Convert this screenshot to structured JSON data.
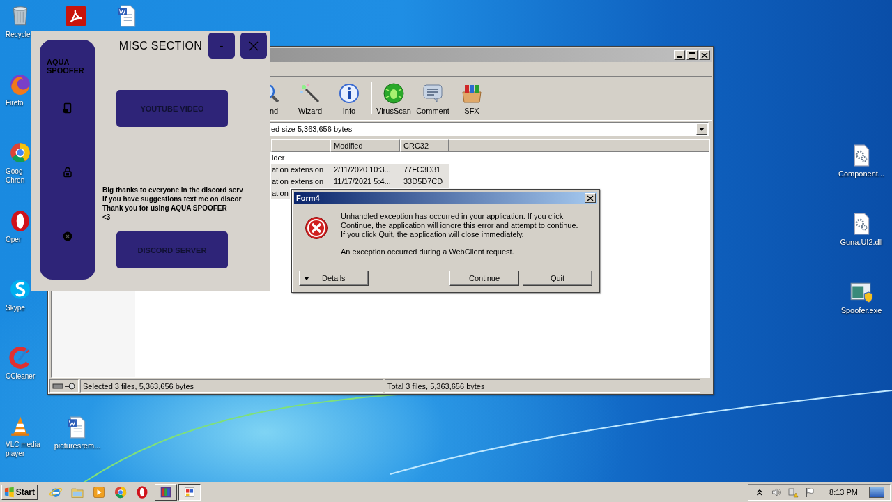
{
  "desktop": {
    "left_icons": [
      {
        "kind": "trash",
        "lines": [
          "Recycle"
        ]
      },
      {
        "kind": "fox",
        "lines": [
          "Firefo"
        ]
      },
      {
        "kind": "wheel",
        "lines": [
          "Goog",
          "Chron"
        ]
      },
      {
        "kind": "ring",
        "lines": [
          "Oper"
        ]
      },
      {
        "kind": "bubble",
        "lines": [
          "Skype"
        ]
      },
      {
        "kind": "brush",
        "lines": [
          "CCleaner"
        ]
      },
      {
        "kind": "cone",
        "lines": [
          "VLC media",
          "player"
        ]
      }
    ],
    "top_icons": [
      {
        "kind": "pdf"
      },
      {
        "kind": "doc"
      }
    ],
    "bottom_icons": [
      {
        "kind": "doc",
        "lines": [
          "picturesrem..."
        ]
      }
    ],
    "right_icons": [
      {
        "kind": "gearfile",
        "lines": [
          "Component..."
        ]
      },
      {
        "kind": "gearfile",
        "lines": [
          "Guna.UI2.dll"
        ]
      },
      {
        "kind": "exe",
        "lines": [
          "Spoofer.exe"
        ]
      }
    ]
  },
  "archiver": {
    "toolbar": [
      {
        "kind": "find",
        "label": "nd"
      },
      {
        "kind": "wand",
        "label": "Wizard"
      },
      {
        "kind": "info",
        "label": "Info"
      },
      {
        "kind": "separator"
      },
      {
        "kind": "bug",
        "label": "VirusScan"
      },
      {
        "kind": "comment",
        "label": "Comment"
      },
      {
        "kind": "sfx",
        "label": "SFX"
      }
    ],
    "path": "ed size 5,363,656 bytes",
    "columns": [
      "Modified",
      "CRC32"
    ],
    "rows": [
      {
        "name": "lder",
        "selected": false
      },
      {
        "name": "ation extension",
        "modified": "2/11/2020 10:3...",
        "crc": "77FC3D31",
        "selected": true
      },
      {
        "name": "ation extension",
        "modified": "11/17/2021 5:4...",
        "crc": "33D5D7CD",
        "selected": true
      },
      {
        "name": "ation",
        "selected": true
      }
    ],
    "status_left": "Selected 3 files, 5,363,656 bytes",
    "status_right": "Total 3 files, 5,363,656 bytes"
  },
  "spoofer": {
    "brand": "AQUA SPOOFER",
    "nav": [
      {
        "kind": "tablet"
      },
      {
        "kind": "lock"
      },
      {
        "kind": "close"
      }
    ],
    "title": "MISC SECTION",
    "minimize": "-",
    "video_button": "YOUTUBE VIDEO",
    "message_lines": [
      "Big thanks to everyone in the discord serv",
      "If you have suggestions text me on discor",
      "Thank you for using AQUA SPOOFER",
      "<3"
    ],
    "server_button": "DISCORD SERVER"
  },
  "dialog": {
    "title": "Form4",
    "message": "Unhandled exception has occurred in your application. If you click Continue, the application will ignore this error and attempt to continue. If you click Quit, the application will close immediately.",
    "detail": "An exception occurred during a WebClient request.",
    "buttons": [
      {
        "kind": "details",
        "label": "Details"
      },
      {
        "kind": "plain",
        "label": "Continue"
      },
      {
        "kind": "plain",
        "label": "Quit"
      }
    ]
  },
  "taskbar": {
    "start": "Start",
    "quick_launch": [
      {
        "kind": "ie"
      },
      {
        "kind": "folder"
      },
      {
        "kind": "media"
      },
      {
        "kind": "wheel"
      },
      {
        "kind": "ring"
      }
    ],
    "tasks": [
      {
        "kind": "archive",
        "selected": false
      },
      {
        "kind": "window",
        "selected": true
      }
    ],
    "tray": [
      {
        "kind": "chevron"
      },
      {
        "kind": "speaker"
      },
      {
        "kind": "network"
      },
      {
        "kind": "flag"
      }
    ],
    "clock": "8:13 PM"
  }
}
